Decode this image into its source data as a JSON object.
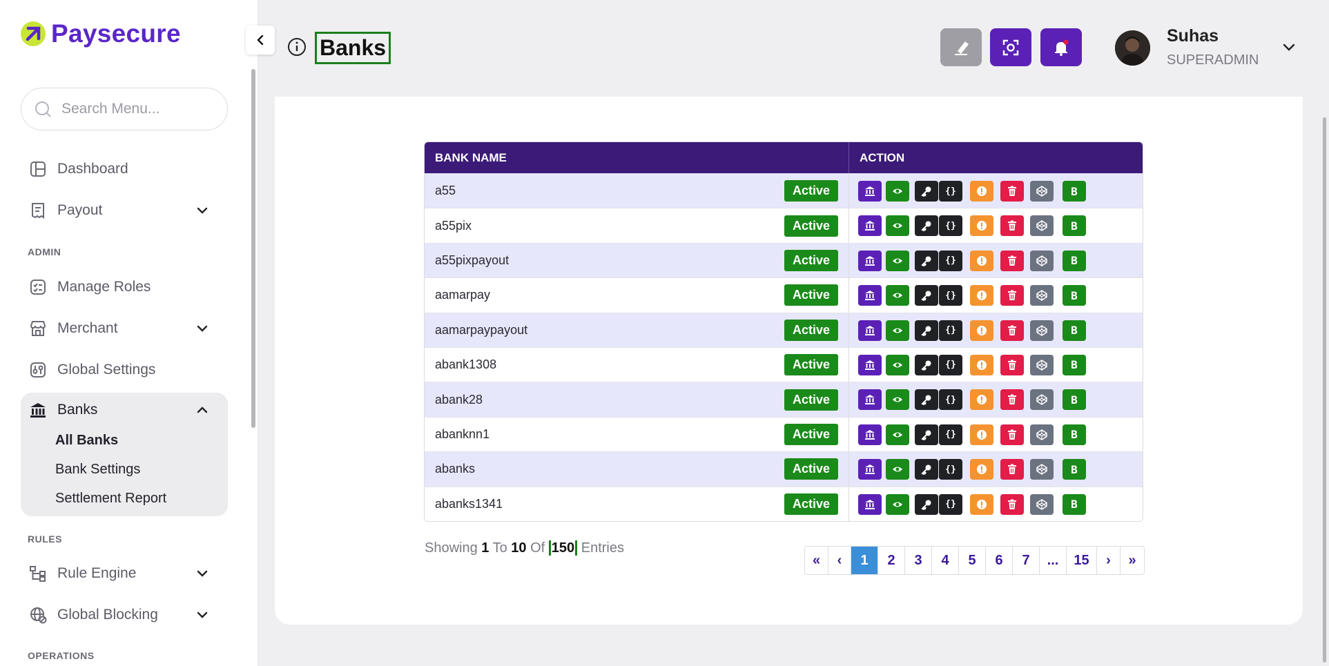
{
  "brand": {
    "name": "Paysecure"
  },
  "search": {
    "placeholder": "Search Menu..."
  },
  "nav": {
    "dashboard": "Dashboard",
    "payout": "Payout",
    "admin_label": "ADMIN",
    "manage_roles": "Manage Roles",
    "merchant": "Merchant",
    "global_settings": "Global Settings",
    "banks": "Banks",
    "banks_sub": [
      "All Banks",
      "Bank Settings",
      "Settlement Report"
    ],
    "rules_label": "RULES",
    "rule_engine": "Rule Engine",
    "global_blocking": "Global Blocking",
    "operations_label": "OPERATIONS"
  },
  "header": {
    "title": "Banks",
    "user_name": "Suhas",
    "user_role": "SUPERADMIN"
  },
  "table": {
    "col_name": "BANK NAME",
    "col_action": "ACTION",
    "rows": [
      {
        "name": "a55",
        "status": "Active"
      },
      {
        "name": "a55pix",
        "status": "Active"
      },
      {
        "name": "a55pixpayout",
        "status": "Active"
      },
      {
        "name": "aamarpay",
        "status": "Active"
      },
      {
        "name": "aamarpaypayout",
        "status": "Active"
      },
      {
        "name": "abank1308",
        "status": "Active"
      },
      {
        "name": "abank28",
        "status": "Active"
      },
      {
        "name": "abanknn1",
        "status": "Active"
      },
      {
        "name": "abanks",
        "status": "Active"
      },
      {
        "name": "abanks1341",
        "status": "Active"
      }
    ],
    "action_buttons": [
      {
        "icon": "bank-icon",
        "color": "#5b21b6"
      },
      {
        "icon": "eye-icon",
        "color": "#1a8a1a"
      },
      {
        "icon": "key-icon",
        "color": "#202124"
      },
      {
        "icon": "code-icon",
        "label": "{}",
        "color": "#202124"
      },
      {
        "icon": "alert-icon",
        "color": "#f59331"
      },
      {
        "icon": "trash-icon",
        "color": "#e11d48"
      },
      {
        "icon": "codepen-icon",
        "color": "#6b7280"
      },
      {
        "icon": "b-icon",
        "label": "B",
        "color": "#1a8a1a"
      }
    ]
  },
  "pagination": {
    "showing_prefix": "Showing",
    "from": "1",
    "to_word": "To",
    "to": "10",
    "of_word": "Of",
    "total": "150",
    "suffix": "Entries",
    "first": "«",
    "prev": "‹",
    "pages": [
      "1",
      "2",
      "3",
      "4",
      "5",
      "6",
      "7",
      "...",
      "15"
    ],
    "next": "›",
    "last": "»",
    "current_page": "1"
  },
  "colors": {
    "brand_purple": "#5a27c8",
    "header_purple": "#3b1a78",
    "active_green": "#1a8a1a",
    "eraser_gray": "#9e9ea4",
    "action_purple": "#5b21b6"
  }
}
